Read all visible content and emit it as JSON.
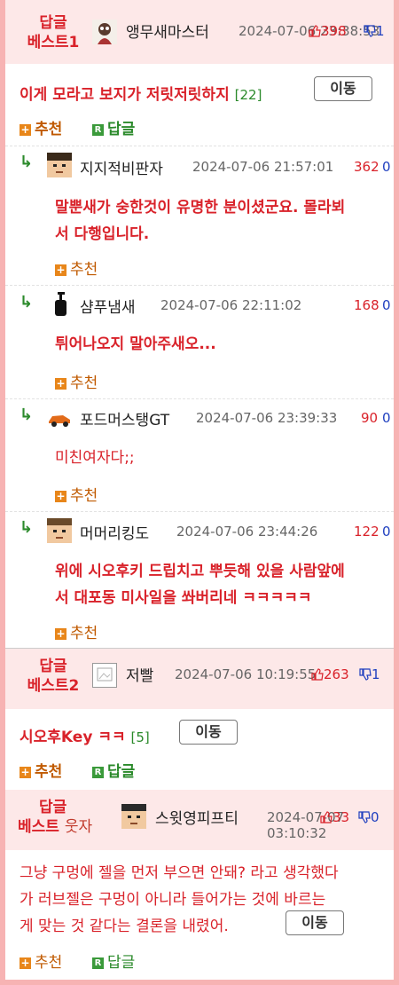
{
  "best1": {
    "tag_line1": "답글",
    "tag_line2": "베스트1",
    "nickname": "앵무새마스터",
    "date": "2024-07-06 23:38:53",
    "up_overlap": "398",
    "down_overlap": "1",
    "title": "이게 모라고 보지가 저릿저릿하지",
    "comment_count": "[22]",
    "move_label": "이동",
    "recommend_label": "추천",
    "reply_label": "답글"
  },
  "replies": [
    {
      "nickname": "지지적비판자",
      "date": "2024-07-06 21:57:01",
      "up": "362",
      "down": "0",
      "text_line1": "말뿐새가 숭한것이 유명한 분이셨군요. 몰라뵈",
      "text_line2": "서 다행입니다.",
      "recommend_label": "추천"
    },
    {
      "nickname": "샴푸냄새",
      "date": "2024-07-06 22:11:02",
      "up": "168",
      "down": "0",
      "text_line1": "튀어나오지 말아주새오...",
      "recommend_label": "추천"
    },
    {
      "nickname": "포드머스탱GT",
      "date": "2024-07-06 23:39:33",
      "up": "90",
      "down": "0",
      "text_line1": "미친여자다;;",
      "recommend_label": "추천"
    },
    {
      "nickname": "머머리킹도",
      "date": "2024-07-06 23:44:26",
      "up": "122",
      "down": "0",
      "text_line1": "위에 시오후키 드립치고 뿌듯해 있을 사람앞에",
      "text_line2": "서 대포동 미사일을 쏴버리네 ㅋㅋㅋㅋㅋ",
      "recommend_label": "추천"
    }
  ],
  "best2": {
    "tag_line1": "답글",
    "tag_line2": "베스트2",
    "nickname": "저빨",
    "date": "2024-07-06 10:19:55",
    "up": "263",
    "down": "1",
    "title": "시오후Key ㅋㅋ",
    "comment_count": "[5]",
    "move_label": "이동",
    "recommend_label": "추천",
    "reply_label": "답글"
  },
  "best3": {
    "tag_line1": "답글",
    "tag_line2": "베스트",
    "tag_extra": "웃자",
    "nickname": "스윗영피프티",
    "date": "2024-07-07 03:10:32",
    "up": "33",
    "down": "0",
    "text_line1": "그냥 구멍에 젤을 먼저 부으면 안돼? 라고 생각했다",
    "text_line2": "가 러브젤은 구멍이 아니라 들어가는 것에 바르는",
    "text_line3": "게 맞는 것 같다는 결론을 내렸어.",
    "move_label": "이동",
    "recommend_label": "추천",
    "reply_label": "답글"
  },
  "colors": {
    "accent_red": "#d9222a",
    "header_bg": "#fde8e8",
    "frame": "#f7b3b3",
    "green": "#2b8a2b",
    "blue": "#1f3fbf"
  }
}
